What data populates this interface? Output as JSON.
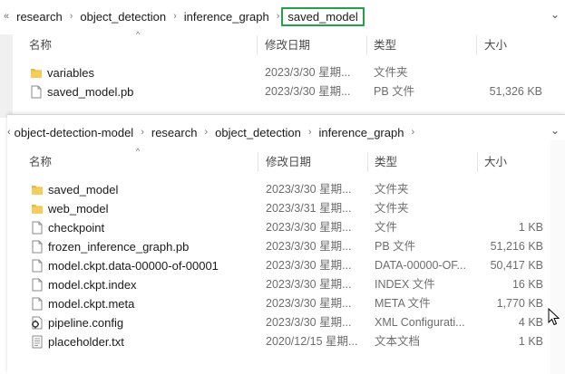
{
  "top_window": {
    "breadcrumb": {
      "overflow": "«",
      "items": [
        "research",
        "object_detection",
        "inference_graph",
        "saved_model"
      ]
    },
    "columns": {
      "name": "名称",
      "date": "修改日期",
      "type": "类型",
      "size": "大小"
    },
    "rows": [
      {
        "name": "variables",
        "date": "2023/3/30 星期...",
        "type": "文件夹",
        "size": "",
        "icon": "folder-icon"
      },
      {
        "name": "saved_model.pb",
        "date": "2023/3/30 星期...",
        "type": "PB 文件",
        "size": "51,326 KB",
        "icon": "file-icon"
      }
    ]
  },
  "bottom_window": {
    "breadcrumb": {
      "overflow": "‹",
      "items": [
        "object-detection-model",
        "research",
        "object_detection",
        "inference_graph"
      ]
    },
    "columns": {
      "name": "名称",
      "date": "修改日期",
      "type": "类型",
      "size": "大小"
    },
    "rows": [
      {
        "name": "saved_model",
        "date": "2023/3/30 星期...",
        "type": "文件夹",
        "size": "",
        "icon": "folder-icon"
      },
      {
        "name": "web_model",
        "date": "2023/3/31 星期...",
        "type": "文件夹",
        "size": "",
        "icon": "folder-icon"
      },
      {
        "name": "checkpoint",
        "date": "2023/3/30 星期...",
        "type": "文件",
        "size": "1 KB",
        "icon": "file-icon"
      },
      {
        "name": "frozen_inference_graph.pb",
        "date": "2023/3/30 星期...",
        "type": "PB 文件",
        "size": "51,216 KB",
        "icon": "file-icon"
      },
      {
        "name": "model.ckpt.data-00000-of-00001",
        "date": "2023/3/30 星期...",
        "type": "DATA-00000-OF...",
        "size": "50,417 KB",
        "icon": "file-icon"
      },
      {
        "name": "model.ckpt.index",
        "date": "2023/3/30 星期...",
        "type": "INDEX 文件",
        "size": "16 KB",
        "icon": "file-icon"
      },
      {
        "name": "model.ckpt.meta",
        "date": "2023/3/30 星期...",
        "type": "META 文件",
        "size": "1,770 KB",
        "icon": "file-icon"
      },
      {
        "name": "pipeline.config",
        "date": "2023/3/30 星期...",
        "type": "XML Configurati...",
        "size": "4 KB",
        "icon": "config-file-icon"
      },
      {
        "name": "placeholder.txt",
        "date": "2020/12/15 星期...",
        "type": "文本文档",
        "size": "1 KB",
        "icon": "text-file-icon"
      }
    ]
  },
  "colors": {
    "folder": "#e8b941",
    "active_crumb_border": "#22a244"
  }
}
